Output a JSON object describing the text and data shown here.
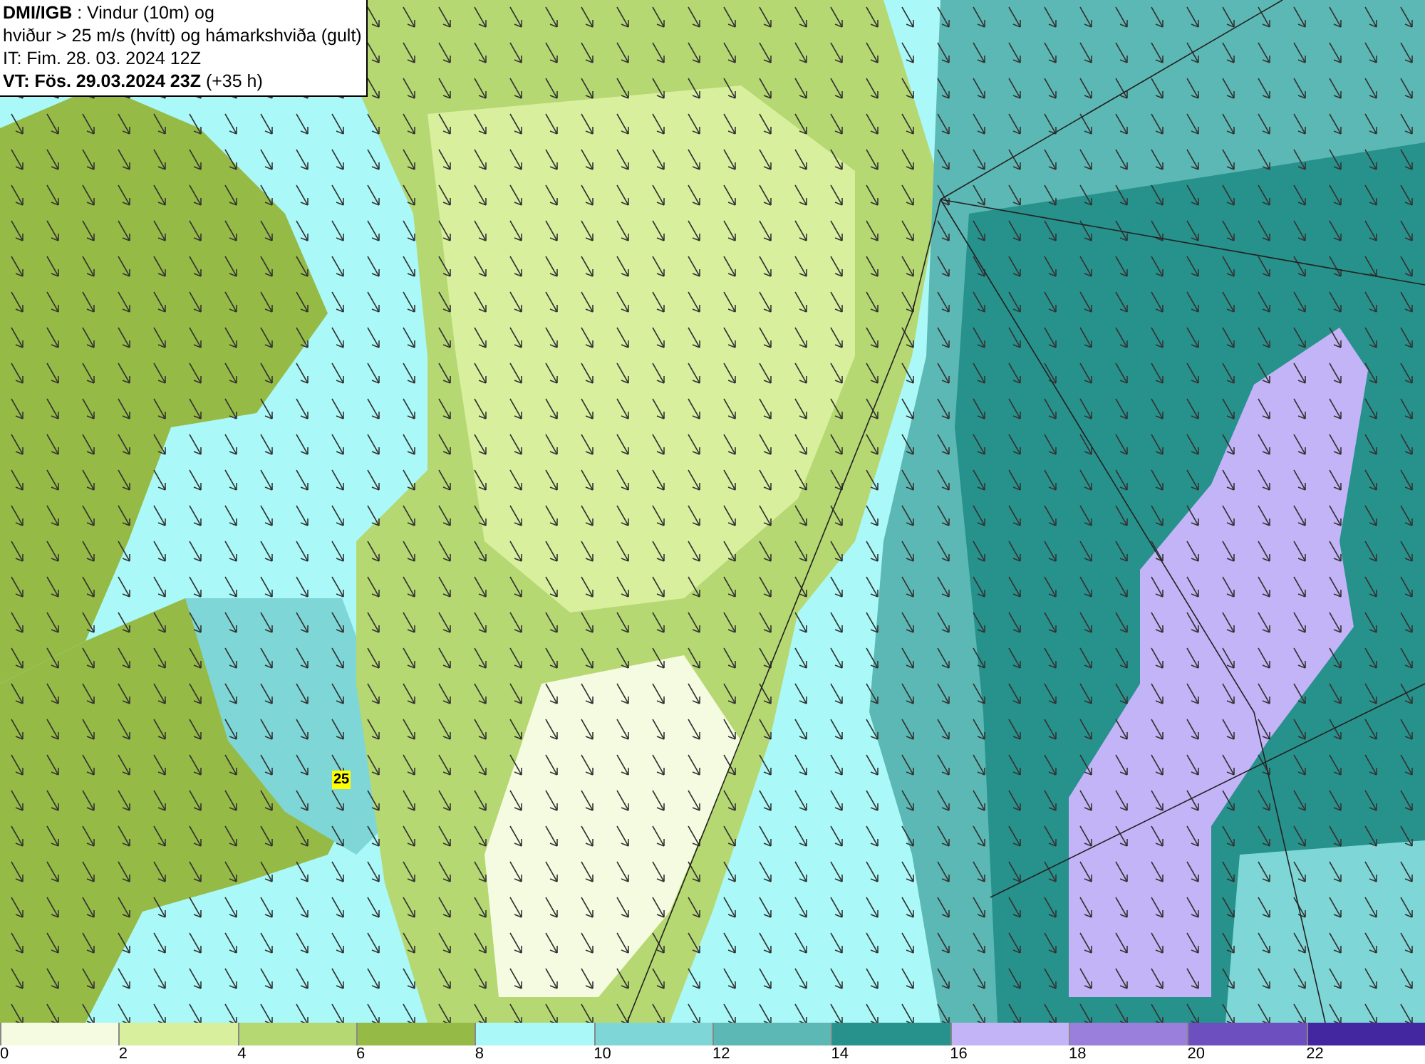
{
  "header": {
    "lines": [
      "**DMI/IGB** : Vindur (10m) og",
      "hviður > 25 m/s (hvítt) og hámarkshviða (gult)",
      "IT: Fim. 28. 03. 2024 12Z",
      "**VT: Fös. 29.03.2024 23Z** (+35 h)"
    ]
  },
  "gust_label": "25",
  "legend": [
    {
      "label": "0",
      "color": "#f5fbe0"
    },
    {
      "label": "2",
      "color": "#d8ef9e"
    },
    {
      "label": "4",
      "color": "#b5d872"
    },
    {
      "label": "6",
      "color": "#95ba45"
    },
    {
      "label": "8",
      "color": "#aaf8f8"
    },
    {
      "label": "10",
      "color": "#7fd6d6"
    },
    {
      "label": "12",
      "color": "#5cb8b4"
    },
    {
      "label": "14",
      "color": "#27918c"
    },
    {
      "label": "16",
      "color": "#c3b3f7"
    },
    {
      "label": "18",
      "color": "#9b7fdc"
    },
    {
      "label": "20",
      "color": "#6e4fc0"
    },
    {
      "label": "22",
      "color": "#4327a0"
    }
  ]
}
